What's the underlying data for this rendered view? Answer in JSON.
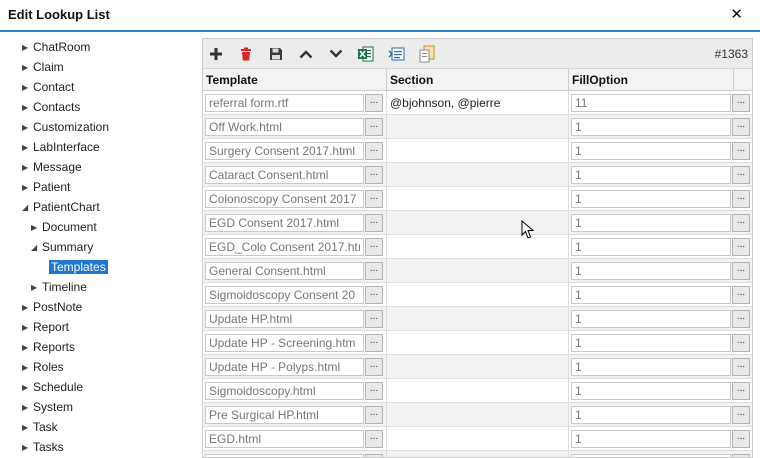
{
  "window": {
    "title": "Edit Lookup List",
    "close_label": "✕"
  },
  "tree": {
    "items": [
      {
        "label": "ChatRoom",
        "level": 0,
        "expanded": false
      },
      {
        "label": "Claim",
        "level": 0,
        "expanded": false
      },
      {
        "label": "Contact",
        "level": 0,
        "expanded": false
      },
      {
        "label": "Contacts",
        "level": 0,
        "expanded": false
      },
      {
        "label": "Customization",
        "level": 0,
        "expanded": false
      },
      {
        "label": "LabInterface",
        "level": 0,
        "expanded": false
      },
      {
        "label": "Message",
        "level": 0,
        "expanded": false
      },
      {
        "label": "Patient",
        "level": 0,
        "expanded": false
      },
      {
        "label": "PatientChart",
        "level": 0,
        "expanded": true
      },
      {
        "label": "Document",
        "level": 1,
        "expanded": false
      },
      {
        "label": "Summary",
        "level": 1,
        "expanded": true
      },
      {
        "label": "Templates",
        "level": 2,
        "selected": true
      },
      {
        "label": "Timeline",
        "level": 1,
        "expanded": false
      },
      {
        "label": "PostNote",
        "level": 0,
        "expanded": false
      },
      {
        "label": "Report",
        "level": 0,
        "expanded": false
      },
      {
        "label": "Reports",
        "level": 0,
        "expanded": false
      },
      {
        "label": "Roles",
        "level": 0,
        "expanded": false
      },
      {
        "label": "Schedule",
        "level": 0,
        "expanded": false
      },
      {
        "label": "System",
        "level": 0,
        "expanded": false
      },
      {
        "label": "Task",
        "level": 0,
        "expanded": false
      },
      {
        "label": "Tasks",
        "level": 0,
        "expanded": false
      }
    ]
  },
  "toolbar": {
    "count": "#1363",
    "buttons": [
      "add-icon",
      "delete-icon",
      "save-icon",
      "move-up-icon",
      "move-down-icon",
      "excel-export-icon",
      "xml-export-icon",
      "copy-icon"
    ],
    "colors": {
      "add": "#333333",
      "delete": "#d9252a",
      "save": "#333333",
      "excel": "#1e7145",
      "xml": "#2b6cb0",
      "copy": "#c8902a"
    }
  },
  "grid": {
    "columns": [
      "Template",
      "Section",
      "FillOption"
    ],
    "ellipsis": "...",
    "rows": [
      {
        "template": "referral form.rtf",
        "section": "@bjohnson, @pierre",
        "fill": "11"
      },
      {
        "template": "Off Work.html",
        "section": "",
        "fill": "1"
      },
      {
        "template": "Surgery Consent 2017.html",
        "section": "",
        "fill": "1"
      },
      {
        "template": "Cataract Consent.html",
        "section": "",
        "fill": "1"
      },
      {
        "template": "Colonoscopy Consent 2017",
        "section": "",
        "fill": "1"
      },
      {
        "template": "EGD Consent 2017.html",
        "section": "",
        "fill": "1"
      },
      {
        "template": "EGD_Colo Consent 2017.htı",
        "section": "",
        "fill": "1"
      },
      {
        "template": "General Consent.html",
        "section": "",
        "fill": "1"
      },
      {
        "template": "Sigmoidoscopy Consent 20",
        "section": "",
        "fill": "1"
      },
      {
        "template": "Update HP.html",
        "section": "",
        "fill": "1"
      },
      {
        "template": "Update HP - Screening.htm",
        "section": "",
        "fill": "1"
      },
      {
        "template": "Update HP - Polyps.html",
        "section": "",
        "fill": "1"
      },
      {
        "template": "Sigmoidoscopy.html",
        "section": "",
        "fill": "1"
      },
      {
        "template": "Pre Surgical HP.html",
        "section": "",
        "fill": "1"
      },
      {
        "template": "EGD.html",
        "section": "",
        "fill": "1"
      },
      {
        "template": "",
        "section": "",
        "fill": ""
      }
    ]
  }
}
